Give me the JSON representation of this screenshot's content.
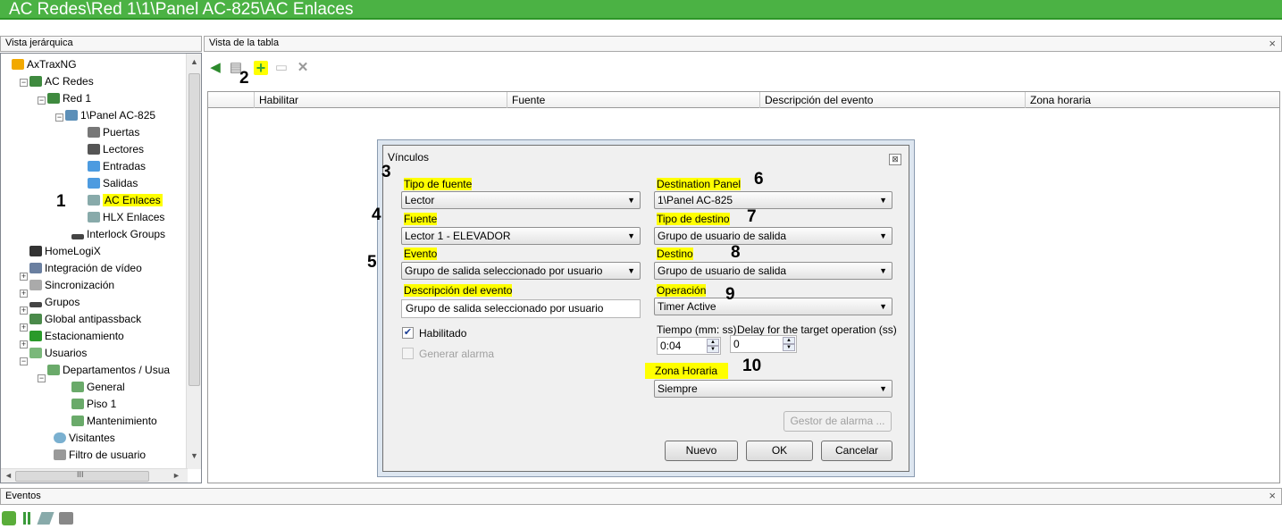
{
  "window": {
    "title": "AC Redes\\Red 1\\1\\Panel  AC-825\\AC Enlaces"
  },
  "left_pane": {
    "header": "Vista jerárquica",
    "tree": [
      {
        "label": "AxTraxNG",
        "icon": "app-icon"
      },
      {
        "label": "AC Redes",
        "icon": "network-icon"
      },
      {
        "label": "Red 1",
        "icon": "network-icon"
      },
      {
        "label": "1\\Panel  AC-825",
        "icon": "panel-icon"
      },
      {
        "label": "Puertas",
        "icon": "door-icon"
      },
      {
        "label": "Lectores",
        "icon": "reader-icon"
      },
      {
        "label": "Entradas",
        "icon": "input-icon"
      },
      {
        "label": "Salidas",
        "icon": "output-icon"
      },
      {
        "label": "AC Enlaces",
        "icon": "link-icon"
      },
      {
        "label": "HLX Enlaces",
        "icon": "link-icon"
      },
      {
        "label": "Interlock Groups",
        "icon": "interlock-icon"
      },
      {
        "label": "HomeLogiX",
        "icon": "homelogix-icon"
      },
      {
        "label": "Integración de vídeo",
        "icon": "video-icon"
      },
      {
        "label": "Sincronización",
        "icon": "sync-icon"
      },
      {
        "label": "Grupos",
        "icon": "groups-icon"
      },
      {
        "label": "Global antipassback",
        "icon": "antipassback-icon"
      },
      {
        "label": "Estacionamiento",
        "icon": "parking-icon"
      },
      {
        "label": "Usuarios",
        "icon": "users-icon"
      },
      {
        "label": "Departamentos / Usua",
        "icon": "department-icon"
      },
      {
        "label": "General",
        "icon": "department-icon"
      },
      {
        "label": "Piso 1",
        "icon": "department-icon"
      },
      {
        "label": "Mantenimiento",
        "icon": "department-icon"
      },
      {
        "label": "Visitantes",
        "icon": "visitor-icon"
      },
      {
        "label": "Filtro de usuario",
        "icon": "filter-icon"
      }
    ],
    "hscroll_label": "III"
  },
  "right_pane": {
    "header": "Vista de la tabla",
    "close": "×",
    "columns": [
      "Habilitar",
      "Fuente",
      "Descripción del evento",
      "Zona horaria"
    ]
  },
  "dialog": {
    "title": "Vínculos",
    "close": "⊠",
    "source_type_label": "Tipo de fuente",
    "source_type_value": "Lector",
    "source_label": "Fuente",
    "source_value": "Lector 1 - ELEVADOR",
    "event_label": "Evento",
    "event_value": "Grupo de salida seleccionado por usuario",
    "event_desc_label": "Descripción del evento",
    "event_desc_value": "Grupo de salida seleccionado por usuario",
    "enabled_label": "Habilitado",
    "enabled": true,
    "alarm_label": "Generar alarma",
    "alarm": false,
    "dest_panel_label": "Destination Panel",
    "dest_panel_value": "1\\Panel  AC-825",
    "dest_type_label": "Tipo de destino",
    "dest_type_value": "Grupo de usuario de salida",
    "dest_label": "Destino",
    "dest_value": "Grupo de usuario de salida",
    "operation_label": "Operación",
    "operation_value": "Timer Active",
    "time_label": "Tiempo (mm: ss)",
    "time_value": "0:04",
    "delay_label": "Delay for the target operation (ss)",
    "delay_value": "0",
    "timezone_label": "Zona Horaria",
    "timezone_value": "Siempre",
    "alarm_manager_label": "Gestor de alarma ...",
    "new_label": "Nuevo",
    "ok_label": "OK",
    "cancel_label": "Cancelar"
  },
  "annotations": [
    "1",
    "2",
    "3",
    "4",
    "5",
    "6",
    "7",
    "8",
    "9",
    "10"
  ],
  "events": {
    "header": "Eventos",
    "close": "×"
  },
  "colors": {
    "title_bar": "#4bb244",
    "highlight": "#ffff00"
  }
}
